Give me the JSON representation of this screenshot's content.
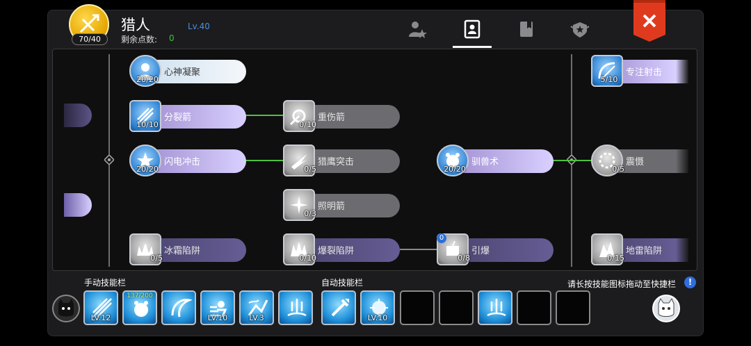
{
  "header": {
    "class_name": "猎人",
    "level": "Lv.40",
    "points_used": "70/40",
    "remaining_label": "剩余点数:",
    "remaining_value": "0",
    "tabs": [
      {
        "name": "profile",
        "icon": "person-star-icon"
      },
      {
        "name": "skills",
        "icon": "skill-book-icon",
        "active": true
      },
      {
        "name": "book",
        "icon": "book-icon"
      },
      {
        "name": "emblem",
        "icon": "winged-star-icon"
      }
    ]
  },
  "skills": {
    "col1": [
      {
        "name": "心神凝聚",
        "count": "20/20",
        "state": "white"
      },
      {
        "name": "分裂箭",
        "count": "10/10",
        "state": "purple"
      },
      {
        "name": "闪电冲击",
        "count": "20/20",
        "state": "purple"
      },
      {
        "name": "冰霜陷阱",
        "count": "0/5",
        "state": "dpurple"
      }
    ],
    "col2": [
      {
        "name": "重伤箭",
        "count": "0/10",
        "state": "grey"
      },
      {
        "name": "猎鹰突击",
        "count": "0/5",
        "state": "grey"
      },
      {
        "name": "照明箭",
        "count": "0/3",
        "state": "grey"
      },
      {
        "name": "爆裂陷阱",
        "count": "0/10",
        "state": "dpurple"
      }
    ],
    "col3": [
      {
        "name": "驯兽术",
        "count": "20/20",
        "state": "purple"
      },
      {
        "name": "引爆",
        "count": "0/8",
        "state": "dpurple",
        "badge": "0"
      }
    ],
    "col4": [
      {
        "name": "专注射击",
        "count": "5/10",
        "state": "purple"
      },
      {
        "name": "震慑",
        "count": "0/5",
        "state": "grey"
      },
      {
        "name": "地雷陷阱",
        "count": "0/15",
        "state": "dpurple"
      }
    ]
  },
  "bottom": {
    "manual_title": "手动技能栏",
    "auto_title": "自动技能栏",
    "hint": "请长按技能图标拖动至快捷栏",
    "info_icon": "!",
    "manual_slots": [
      {
        "lv": "LV.12"
      },
      {
        "xp": "137/200"
      },
      {
        "lv": ""
      },
      {
        "lv": "LV.10"
      },
      {
        "lv": "LV.3"
      },
      {
        "lv": ""
      }
    ],
    "auto_slots": [
      {
        "lv": ""
      },
      {
        "lv": "LV.10"
      }
    ]
  },
  "colors": {
    "accent_blue": "#4a90e2",
    "remaining_green": "#39c73a",
    "close_red": "#e03a1e"
  }
}
